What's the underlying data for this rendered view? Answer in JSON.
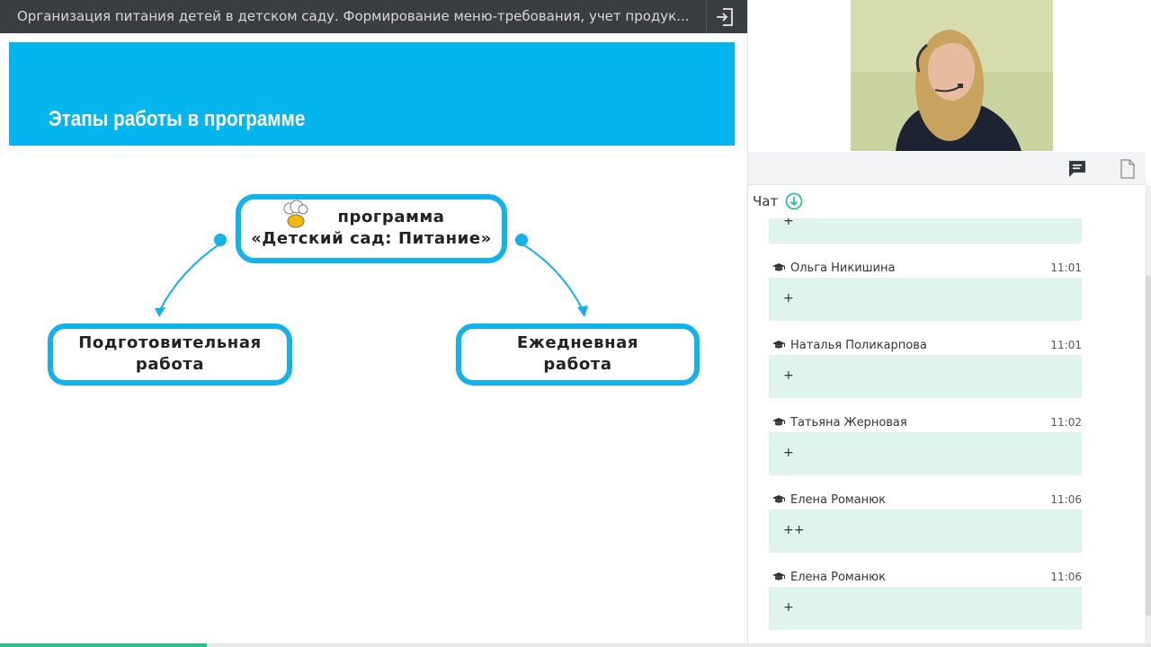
{
  "header": {
    "title": "Организация питания детей в детском саду. Формирование меню-требования, учет продук...",
    "exit_icon": "exit-icon"
  },
  "slide": {
    "heading": "Этапы работы в программе",
    "banner_color": "#05b5ee",
    "nodes": {
      "program_line1": "программа",
      "program_line2": "«Детский сад: Питание»",
      "prep_line1": "Подготовительная",
      "prep_line2": "работа",
      "daily_line1": "Ежедневная",
      "daily_line2": "работа"
    },
    "node_border_color": "#12b2ea"
  },
  "panel": {
    "tabs": [
      {
        "icon": "chat-icon",
        "active": true
      },
      {
        "icon": "document-icon",
        "active": false
      }
    ],
    "chat_title": "Чат",
    "chat_scroll_icon": "arrow-down-circle-icon",
    "first_message_text": "+",
    "messages": [
      {
        "author": "Ольга Никишина",
        "time": "11:01",
        "text": "+"
      },
      {
        "author": "Наталья Поликарпова",
        "time": "11:01",
        "text": "+"
      },
      {
        "author": "Татьяна Жерновая",
        "time": "11:02",
        "text": "+"
      },
      {
        "author": "Елена Романюк",
        "time": "11:06",
        "text": "++"
      },
      {
        "author": "Елена Романюк",
        "time": "11:06",
        "text": "+"
      }
    ],
    "accent_color": "#2dbf8c",
    "bubble_color": "#dff4ec"
  },
  "progress": {
    "fraction": 0.18
  }
}
